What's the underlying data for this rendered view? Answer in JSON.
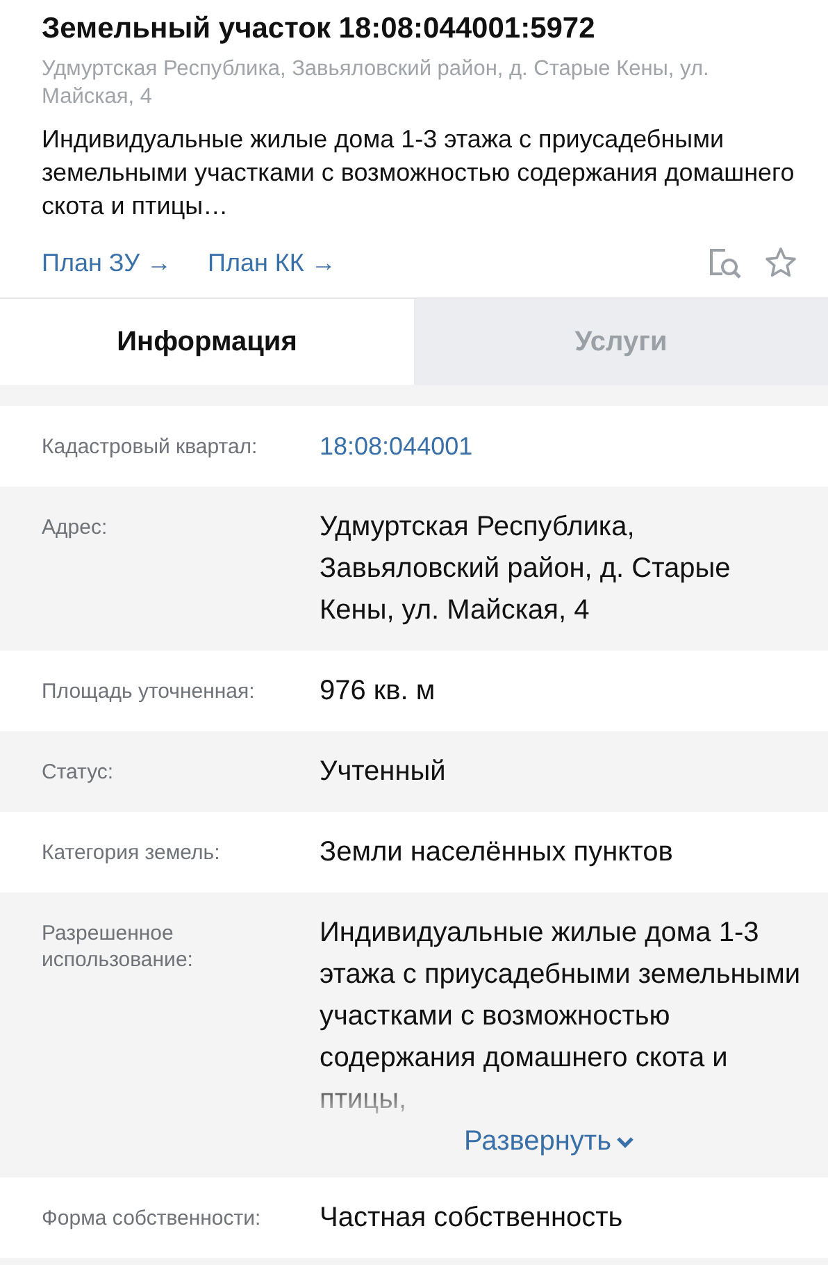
{
  "header": {
    "title": "Земельный участок 18:08:044001:5972",
    "address": "Удмуртская Республика, Завьяловский район, д. Старые Кены, ул. Майская, 4",
    "description": "Индивидуальные жилые дома 1-3 этажа с приусадебными земельными участками с возможностью содержания домашнего скота и птицы…",
    "links": [
      "План ЗУ →",
      "План КК →"
    ]
  },
  "tabs": [
    {
      "label": "Информация",
      "selected": true
    },
    {
      "label": "Услуги",
      "selected": false
    }
  ],
  "fields": [
    {
      "label": "Кадастровый квартал:",
      "value": "18:08:044001",
      "kind": "link"
    },
    {
      "label": "Адрес:",
      "value": "Удмуртская Республика, Завьяловский район, д. Старые Кены, ул. Майская, 4",
      "kind": "text"
    },
    {
      "label": "Площадь уточненная:",
      "value": "976 кв. м",
      "kind": "text"
    },
    {
      "label": "Статус:",
      "value": "Учтенный",
      "kind": "text"
    },
    {
      "label": "Категория земель:",
      "value": "Земли населённых пунктов",
      "kind": "text"
    },
    {
      "label": "Разрешенное использование:",
      "value": "Индивидуальные жилые дома 1-3 этажа с приусадебными земельными участками с возможностью содержания домашнего скота и птицы,",
      "kind": "collapsed",
      "expand": "Развернуть"
    },
    {
      "label": "Форма собственности:",
      "value": "Частная собственность",
      "kind": "text"
    }
  ]
}
